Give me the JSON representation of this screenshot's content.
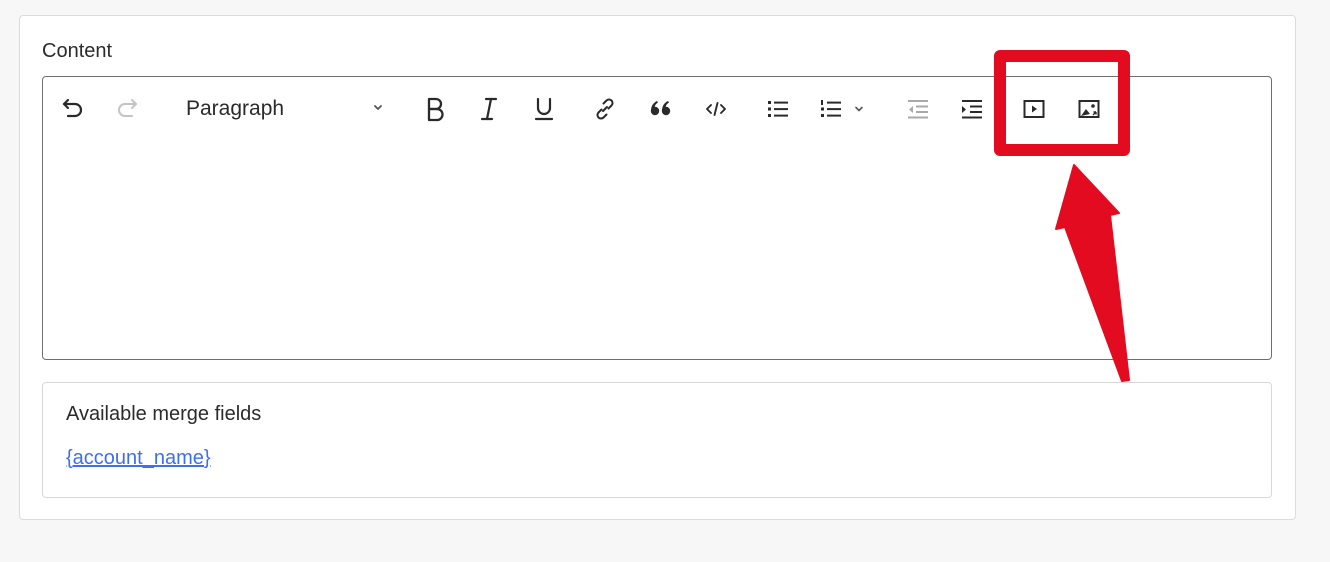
{
  "field": {
    "label": "Content"
  },
  "toolbar": {
    "format_select": {
      "value": "Paragraph"
    },
    "icons": {
      "undo": "undo-icon",
      "redo": "redo-icon",
      "bold": "bold-icon",
      "italic": "italic-icon",
      "underline": "underline-icon",
      "link": "link-icon",
      "quote": "blockquote-icon",
      "code": "code-icon",
      "bulleted_list": "bulleted-list-icon",
      "numbered_list": "numbered-list-icon",
      "outdent": "outdent-icon",
      "indent": "indent-icon",
      "media": "media-embed-icon",
      "image": "image-insert-icon"
    }
  },
  "editor": {
    "content": ""
  },
  "merge_fields": {
    "title": "Available merge fields",
    "items": [
      "{account_name}"
    ]
  },
  "annotation": {
    "highlight_color": "#e30b20"
  }
}
